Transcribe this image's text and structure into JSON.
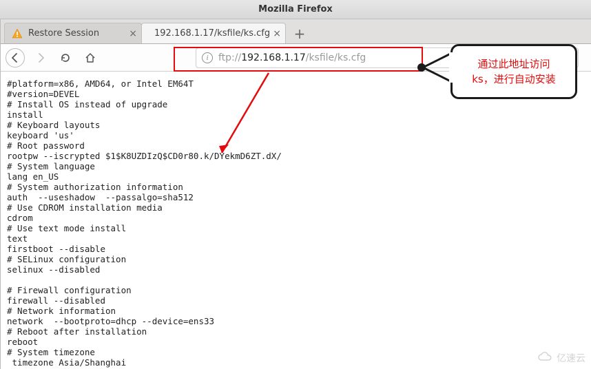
{
  "window": {
    "title": "Mozilla Firefox"
  },
  "tabs": [
    {
      "label": "Restore Session",
      "icon": "warning"
    },
    {
      "label": "192.168.1.17/ksfile/ks.cfg",
      "icon": "none"
    }
  ],
  "newtab_label": "+",
  "nav": {
    "back": "←",
    "forward": "→",
    "reload": "⟳",
    "home": "⌂"
  },
  "url": {
    "scheme": "ftp://",
    "host": "192.168.1.17",
    "path": "/ksfile/ks.cfg"
  },
  "annotation": {
    "text_line1": "通过此地址访问",
    "text_line2": "ks，进行自动安装"
  },
  "file_lines": [
    "#platform=x86, AMD64, or Intel EM64T",
    "#version=DEVEL",
    "# Install OS instead of upgrade",
    "install",
    "# Keyboard layouts",
    "keyboard 'us'",
    "# Root password",
    "rootpw --iscrypted $1$K8UZDIzQ$CD0r80.k/DYekmD6ZT.dX/",
    "# System language",
    "lang en_US",
    "# System authorization information",
    "auth  --useshadow  --passalgo=sha512",
    "# Use CDROM installation media",
    "cdrom",
    "# Use text mode install",
    "text",
    "firstboot --disable",
    "# SELinux configuration",
    "selinux --disabled",
    "",
    "# Firewall configuration",
    "firewall --disabled",
    "# Network information",
    "network  --bootproto=dhcp --device=ens33",
    "# Reboot after installation",
    "reboot",
    "# System timezone",
    " timezone Asia/Shanghai"
  ],
  "watermark": {
    "text": "亿速云"
  }
}
